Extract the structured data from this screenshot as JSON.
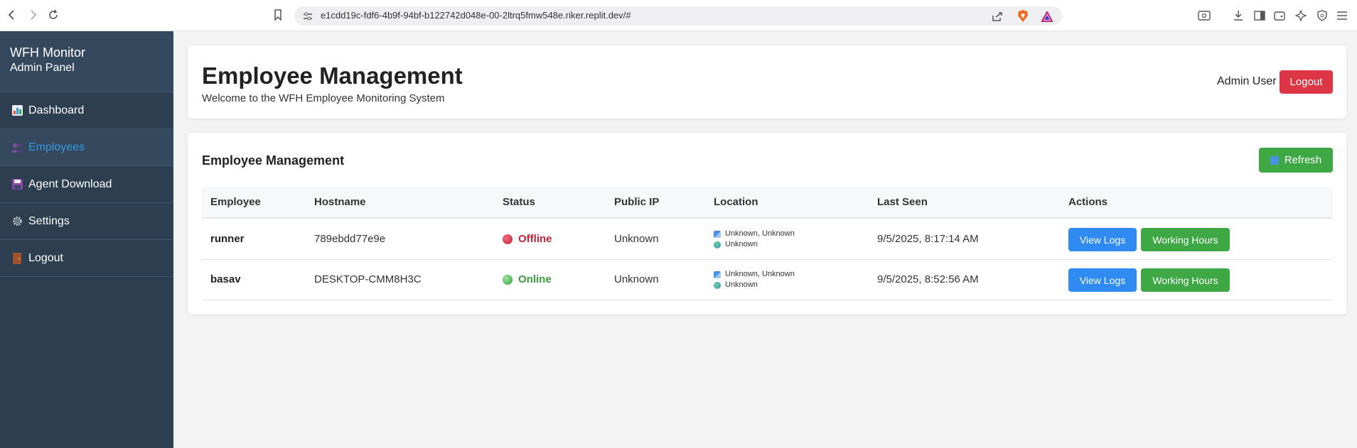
{
  "browser": {
    "url": "e1cdd19c-fdf6-4b9f-94bf-b122742d048e-00-2ltrq5fmw548e.riker.replit.dev/#"
  },
  "sidebar": {
    "brand_title": "WFH Monitor",
    "brand_subtitle": "Admin Panel",
    "items": [
      {
        "label": "Dashboard",
        "icon": "bar-chart-icon"
      },
      {
        "label": "Employees",
        "icon": "people-icon",
        "active": true
      },
      {
        "label": "Agent Download",
        "icon": "floppy-disk-icon"
      },
      {
        "label": "Settings",
        "icon": "gear-icon"
      },
      {
        "label": "Logout",
        "icon": "door-icon"
      }
    ]
  },
  "header": {
    "title": "Employee Management",
    "subtitle": "Welcome to the WFH Employee Monitoring System",
    "user_label": "Admin User",
    "logout_label": "Logout"
  },
  "panel": {
    "title": "Employee Management",
    "refresh_label": "Refresh",
    "columns": [
      "Employee",
      "Hostname",
      "Status",
      "Public IP",
      "Location",
      "Last Seen",
      "Actions"
    ],
    "rows": [
      {
        "employee": "runner",
        "hostname": "789ebdd77e9e",
        "status": "Offline",
        "status_color": "#c0243a",
        "public_ip": "Unknown",
        "location_city": "Unknown, Unknown",
        "location_country": "Unknown",
        "last_seen": "9/5/2025, 8:17:14 AM",
        "view_logs": "View Logs",
        "working_hours": "Working Hours"
      },
      {
        "employee": "basav",
        "hostname": "DESKTOP-CMM8H3C",
        "status": "Online",
        "status_color": "#3a9a3e",
        "public_ip": "Unknown",
        "location_city": "Unknown, Unknown",
        "location_country": "Unknown",
        "last_seen": "9/5/2025, 8:52:56 AM",
        "view_logs": "View Logs",
        "working_hours": "Working Hours"
      }
    ]
  },
  "colors": {
    "sidebar_bg": "#2c3e50",
    "active_link": "#3498db",
    "danger": "#dc3545",
    "success": "#3ea845",
    "primary": "#2f8bf2"
  }
}
